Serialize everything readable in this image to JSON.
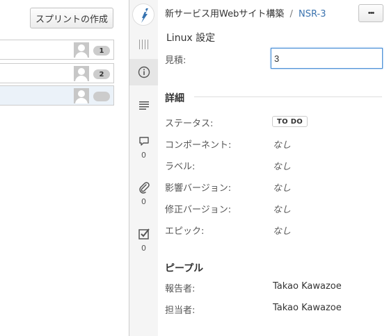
{
  "board": {
    "create_sprint_label": "スプリントの作成",
    "rows": [
      {
        "count": "1",
        "selected": false
      },
      {
        "count": "2",
        "selected": false
      },
      {
        "count": "",
        "selected": true
      }
    ]
  },
  "rail": {
    "comments_count": "0",
    "attachments_count": "0",
    "subtasks_count": "0"
  },
  "issue": {
    "project_name": "新サービス用Webサイト構築",
    "separator": "/",
    "key": "NSR-3",
    "more_label": "•••",
    "summary": "Linux 設定",
    "estimate_label": "見積:",
    "estimate_value": "3"
  },
  "details": {
    "heading": "詳細",
    "status_label": "ステータス:",
    "status_value": "TO DO",
    "component_label": "コンポーネント:",
    "component_value": "なし",
    "labels_label": "ラベル:",
    "labels_value": "なし",
    "affects_label": "影響バージョン:",
    "affects_value": "なし",
    "fix_label": "修正バージョン:",
    "fix_value": "なし",
    "epic_label": "エピック:",
    "epic_value": "なし"
  },
  "people": {
    "heading": "ピープル",
    "reporter_label": "報告者:",
    "reporter_value": "Takao Kawazoe",
    "assignee_label": "担当者:",
    "assignee_value": "Takao Kawazoe"
  },
  "colors": {
    "link": "#3b73af",
    "focus": "#4a8fd6",
    "selected_row": "#ebf2f9"
  }
}
